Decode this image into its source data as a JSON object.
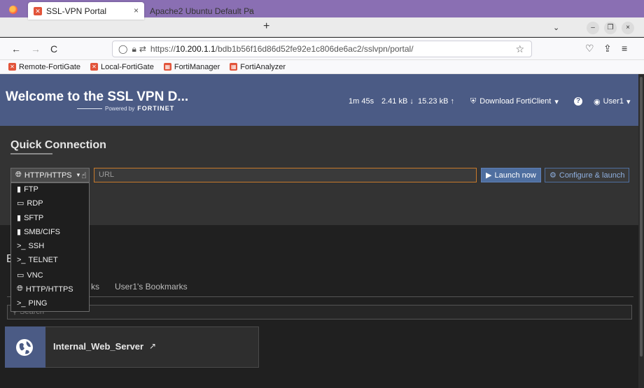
{
  "browser": {
    "tabs": [
      {
        "label": "SSL-VPN Portal",
        "close": "×"
      },
      {
        "label": "Apache2 Ubuntu Default Pa",
        "close": "×"
      }
    ],
    "new_tab": "+",
    "tab_list": "⌄",
    "window_controls": {
      "minimize": "–",
      "restore": "❐",
      "close": "×"
    },
    "nav": {
      "back": "←",
      "forward": "→",
      "reload": "C"
    },
    "url_prefix": "https://",
    "url_host": "10.200.1.1",
    "url_path": "/bdb1b56f16d86d52fe92e1c806de6ac2/sslvpn/portal/",
    "bookmarks": [
      "Remote-FortiGate",
      "Local-FortiGate",
      "FortiManager",
      "FortiAnalyzer"
    ]
  },
  "header": {
    "title": "Welcome to the SSL VPN D...",
    "powered_by": "Powered by",
    "brand": "FORTINET",
    "session_time": "1m 45s",
    "download_stat": "2.41 kB ↓",
    "upload_stat": "15.23 kB ↑",
    "download_client": "Download FortiClient",
    "help": "?",
    "user": "User1"
  },
  "quick_connection": {
    "title": "Quick Connection",
    "selected_protocol": "HTTP/HTTPS",
    "url_placeholder": "URL",
    "launch_label": "Launch now",
    "configure_label": "Configure & launch",
    "protocol_options": [
      {
        "label": "FTP",
        "icon": "file-icon"
      },
      {
        "label": "RDP",
        "icon": "monitor-icon"
      },
      {
        "label": "SFTP",
        "icon": "file-icon"
      },
      {
        "label": "SMB/CIFS",
        "icon": "file-icon"
      },
      {
        "label": "SSH",
        "icon": "terminal-icon"
      },
      {
        "label": "TELNET",
        "icon": "terminal-icon"
      },
      {
        "label": "VNC",
        "icon": "monitor-icon"
      },
      {
        "label": "HTTP/HTTPS",
        "icon": "globe-icon"
      },
      {
        "label": "PING",
        "icon": "terminal-icon"
      }
    ]
  },
  "bookmarks_section": {
    "letter": "B",
    "tab_partial": "ks",
    "tab_user": "User1's Bookmarks",
    "search_placeholder": "Search",
    "items": [
      {
        "label": "Internal_Web_Server",
        "ext": "↗"
      }
    ]
  },
  "colors": {
    "header_bg": "#4b5b85",
    "accent": "#4f6fa0",
    "input_border": "#c77a2b"
  }
}
